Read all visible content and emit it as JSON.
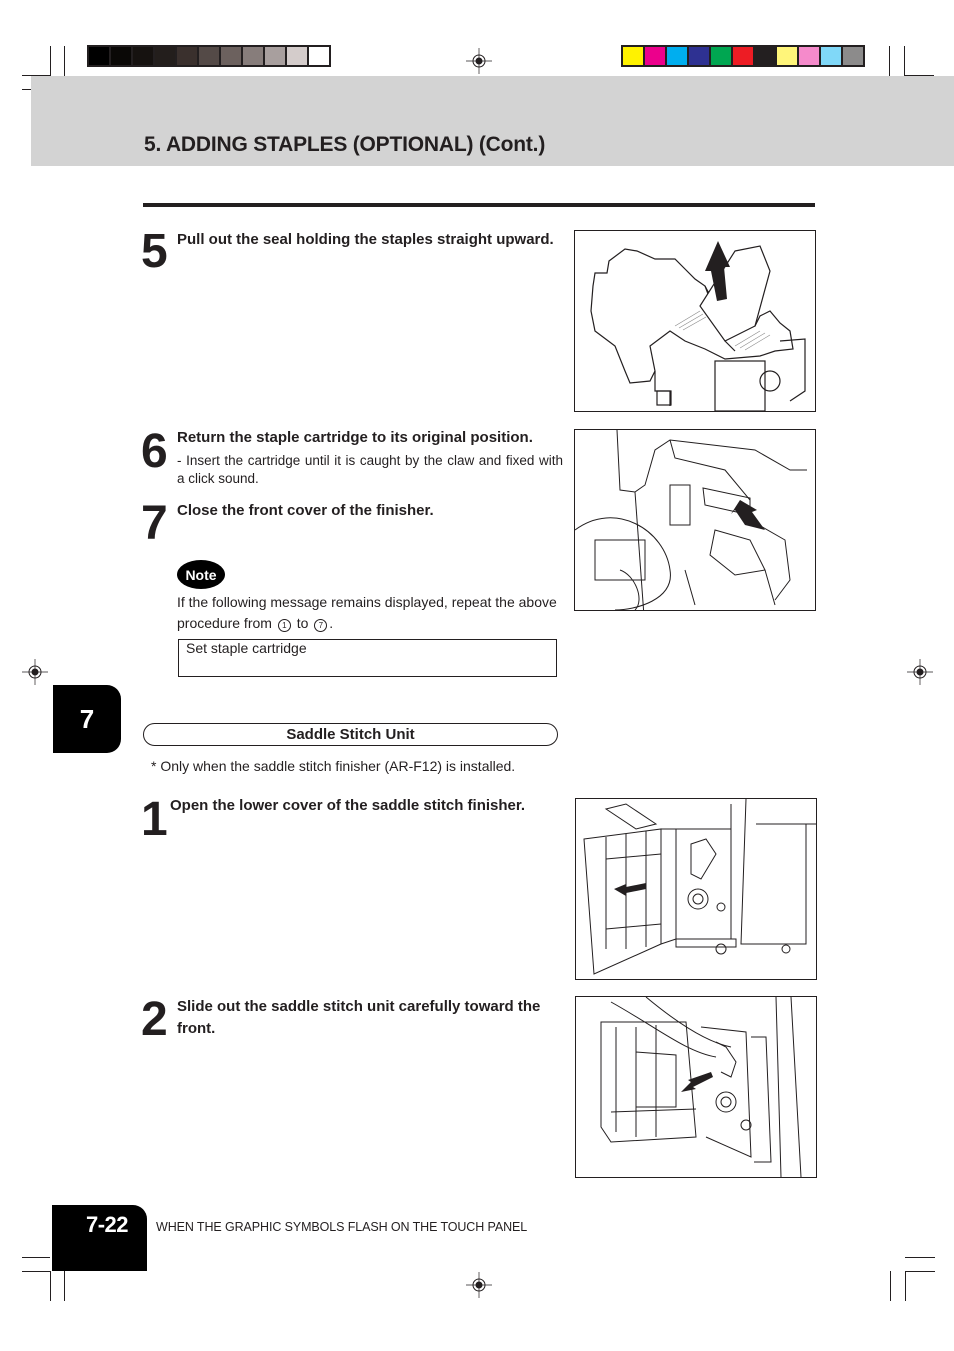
{
  "color_bars": {
    "gray": [
      "#000000",
      "#0a0806",
      "#161210",
      "#231e1c",
      "#3a302d",
      "#544a47",
      "#6c615e",
      "#877d7b",
      "#a89f9e",
      "#d4cccb",
      "#ffffff"
    ],
    "process": [
      "#fff200",
      "#ec008c",
      "#00aeef",
      "#2e3192",
      "#00a651",
      "#ed1c24",
      "#231f20",
      "#fff57a",
      "#f58acb",
      "#80d8f8",
      "#8c8b8b"
    ]
  },
  "header": {
    "title": "5. ADDING STAPLES (OPTIONAL) (Cont.)"
  },
  "steps_top": [
    {
      "number": "5",
      "instruction": "Pull out the seal holding the staples straight upward.",
      "figure": "staple-cartridge-seal-removal-illustration"
    },
    {
      "number": "6",
      "instruction": "Return the staple cartridge to its original position.",
      "detail": "- Insert the cartridge until it is caught by the claw and fixed with a click sound.",
      "figure": "insert-staple-cartridge-illustration"
    },
    {
      "number": "7",
      "instruction": "Close the front cover of the finisher."
    }
  ],
  "note": {
    "badge": "Note",
    "text_before": "If the following message remains displayed, repeat the above procedure from",
    "from_step": "1",
    "to_word": "to",
    "to_step": "7",
    "period": ".",
    "message": "Set staple cartridge"
  },
  "chapter_tab": "7",
  "section": {
    "title": "Saddle Stitch Unit",
    "footnote": "* Only when the saddle stitch finisher (AR-F12) is installed."
  },
  "steps_bottom": [
    {
      "number": "1",
      "instruction": "Open the lower cover of the saddle stitch finisher.",
      "figure": "open-lower-cover-illustration"
    },
    {
      "number": "2",
      "instruction": "Slide out the saddle stitch unit carefully toward the front.",
      "figure": "slide-out-saddle-stitch-unit-illustration"
    }
  ],
  "footer": {
    "page_number": "7-22",
    "section_title": "WHEN THE GRAPHIC SYMBOLS FLASH ON THE TOUCH PANEL"
  }
}
